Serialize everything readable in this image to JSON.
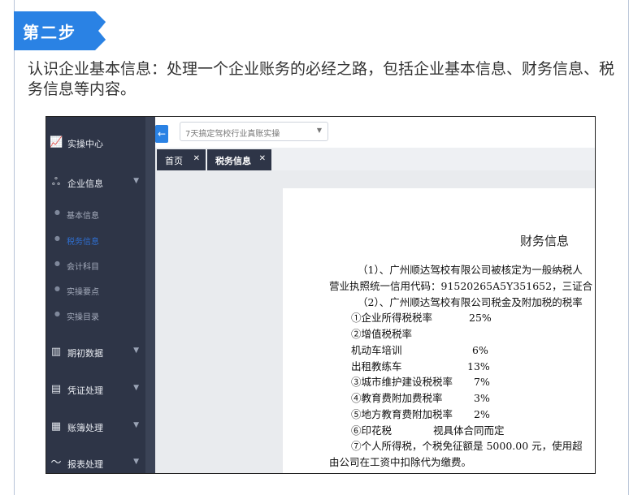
{
  "step": {
    "label": "第二步"
  },
  "intro": {
    "text": "认识企业基本信息：处理一个企业账务的必经之路，包括企业基本信息、财务信息、税务信息等内容。"
  },
  "colors": {
    "accent": "#2a82e4",
    "sidebar": "#2e3547",
    "active_sub": "#2f6fd0"
  },
  "app": {
    "sidebar": {
      "items": [
        {
          "label": "实操中心",
          "icon": "chart-line-icon"
        },
        {
          "label": "企业信息",
          "icon": "cluster-icon"
        },
        {
          "label": "期初数据",
          "icon": "bar-chart-icon"
        },
        {
          "label": "凭证处理",
          "icon": "voucher-icon"
        },
        {
          "label": "账簿处理",
          "icon": "ledger-icon"
        },
        {
          "label": "报表处理",
          "icon": "trend-icon"
        }
      ],
      "subitems": [
        {
          "label": "基本信息"
        },
        {
          "label": "税务信息"
        },
        {
          "label": "会计科目"
        },
        {
          "label": "实操要点"
        },
        {
          "label": "实操目录"
        }
      ]
    },
    "topbar": {
      "selected_course": "7天搞定驾校行业真账实操"
    },
    "tabs": [
      {
        "label": "首页"
      },
      {
        "label": "税务信息"
      }
    ],
    "document": {
      "title": "财务信息",
      "lines": [
        "（1）、广州顺达驾校有限公司被核定为一般纳税人",
        "营业执照统一信用代码：91520265A5Y351652，三证合",
        "（2）、广州顺达驾校有限公司税金及附加税的税率",
        "①企业所得税税率",
        "②增值税税率",
        "机动车培训",
        "出租教练车",
        "③城市维护建设税税率",
        "④教育费附加费税率",
        "⑤地方教育费附加税率",
        "⑥印花税",
        "⑦个人所得税，个税免征额是 5000.00 元，使用超",
        "由公司在工资中扣除代为缴费。"
      ],
      "values": [
        "25%",
        "6%",
        "13%",
        "7%",
        "3%",
        "2%",
        "视具体合同而定"
      ]
    }
  }
}
